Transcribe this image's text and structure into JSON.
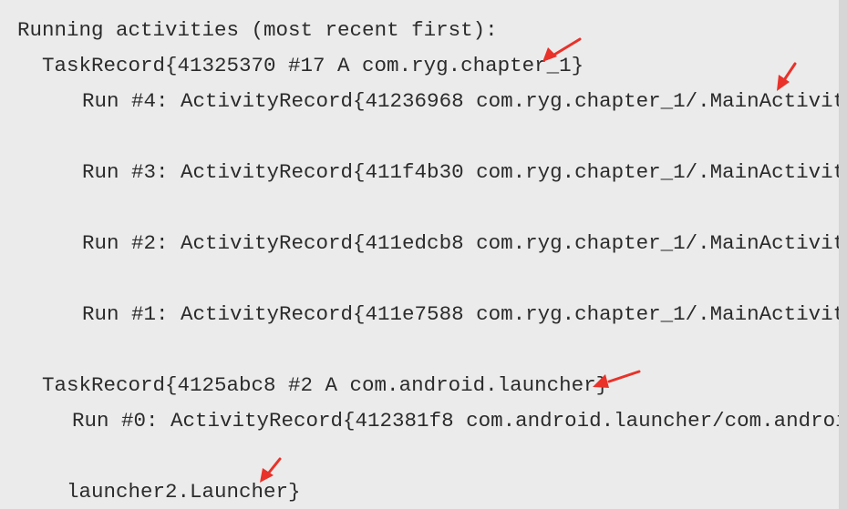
{
  "console": {
    "header": "Running activities (most recent first):",
    "task1": {
      "record": "TaskRecord{41325370 #17 A com.ryg.chapter_1}",
      "runs": [
        "Run #4: ActivityRecord{41236968 com.ryg.chapter_1/.MainActivit",
        "Run #3: ActivityRecord{411f4b30 com.ryg.chapter_1/.MainActivit",
        "Run #2: ActivityRecord{411edcb8 com.ryg.chapter_1/.MainActivit",
        "Run #1: ActivityRecord{411e7588 com.ryg.chapter_1/.MainActivit"
      ]
    },
    "task2": {
      "record": "TaskRecord{4125abc8 #2 A com.android.launcher}",
      "run0": "Run #0: ActivityRecord{412381f8 com.android.launcher/com.androi",
      "run0_cont": "launcher2.Launcher}"
    }
  },
  "annotations": {
    "arrow_color": "#e8322a"
  }
}
